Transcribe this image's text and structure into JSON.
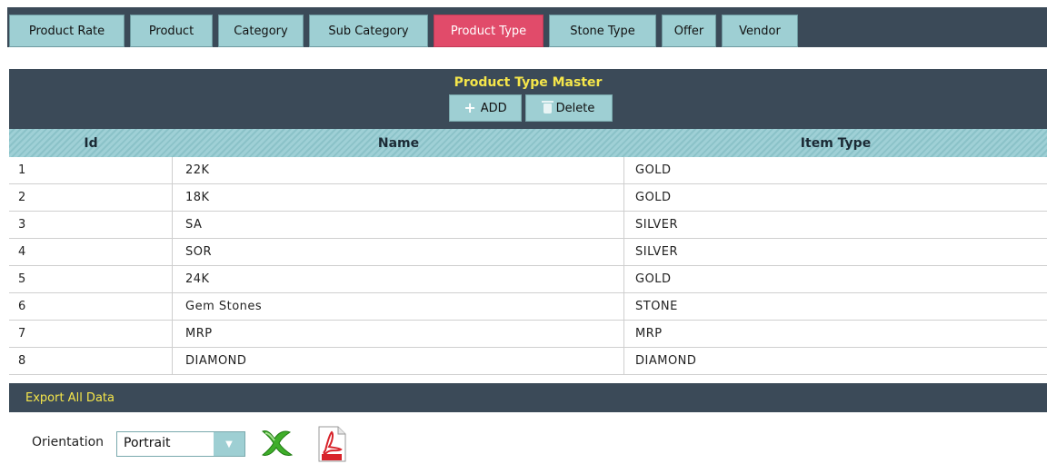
{
  "tabs": [
    {
      "label": "Product Rate",
      "active": false
    },
    {
      "label": "Product",
      "active": false
    },
    {
      "label": "Category",
      "active": false
    },
    {
      "label": "Sub Category",
      "active": false
    },
    {
      "label": "Product Type",
      "active": true
    },
    {
      "label": "Stone Type",
      "active": false
    },
    {
      "label": "Offer",
      "active": false
    },
    {
      "label": "Vendor",
      "active": false
    }
  ],
  "master": {
    "title": "Product Type Master",
    "add_label": "ADD",
    "delete_label": "Delete"
  },
  "table": {
    "columns": [
      "Id",
      "Name",
      "Item Type"
    ],
    "rows": [
      {
        "id": "1",
        "name": "22K",
        "item_type": "GOLD"
      },
      {
        "id": "2",
        "name": "18K",
        "item_type": "GOLD"
      },
      {
        "id": "3",
        "name": "SA",
        "item_type": "SILVER"
      },
      {
        "id": "4",
        "name": "SOR",
        "item_type": "SILVER"
      },
      {
        "id": "5",
        "name": "24K",
        "item_type": "GOLD"
      },
      {
        "id": "6",
        "name": "Gem Stones",
        "item_type": "STONE"
      },
      {
        "id": "7",
        "name": "MRP",
        "item_type": "MRP"
      },
      {
        "id": "8",
        "name": "DIAMOND",
        "item_type": "DIAMOND"
      }
    ]
  },
  "export": {
    "link_label": "Export All Data",
    "orientation_label": "Orientation",
    "orientation_value": "Portrait",
    "icons": [
      "excel-icon",
      "pdf-icon"
    ]
  },
  "colors": {
    "header_dark": "#3b4a58",
    "tab_bg": "#9ecfd3",
    "tab_active": "#e14b6a",
    "title_yellow": "#f5e64a"
  }
}
